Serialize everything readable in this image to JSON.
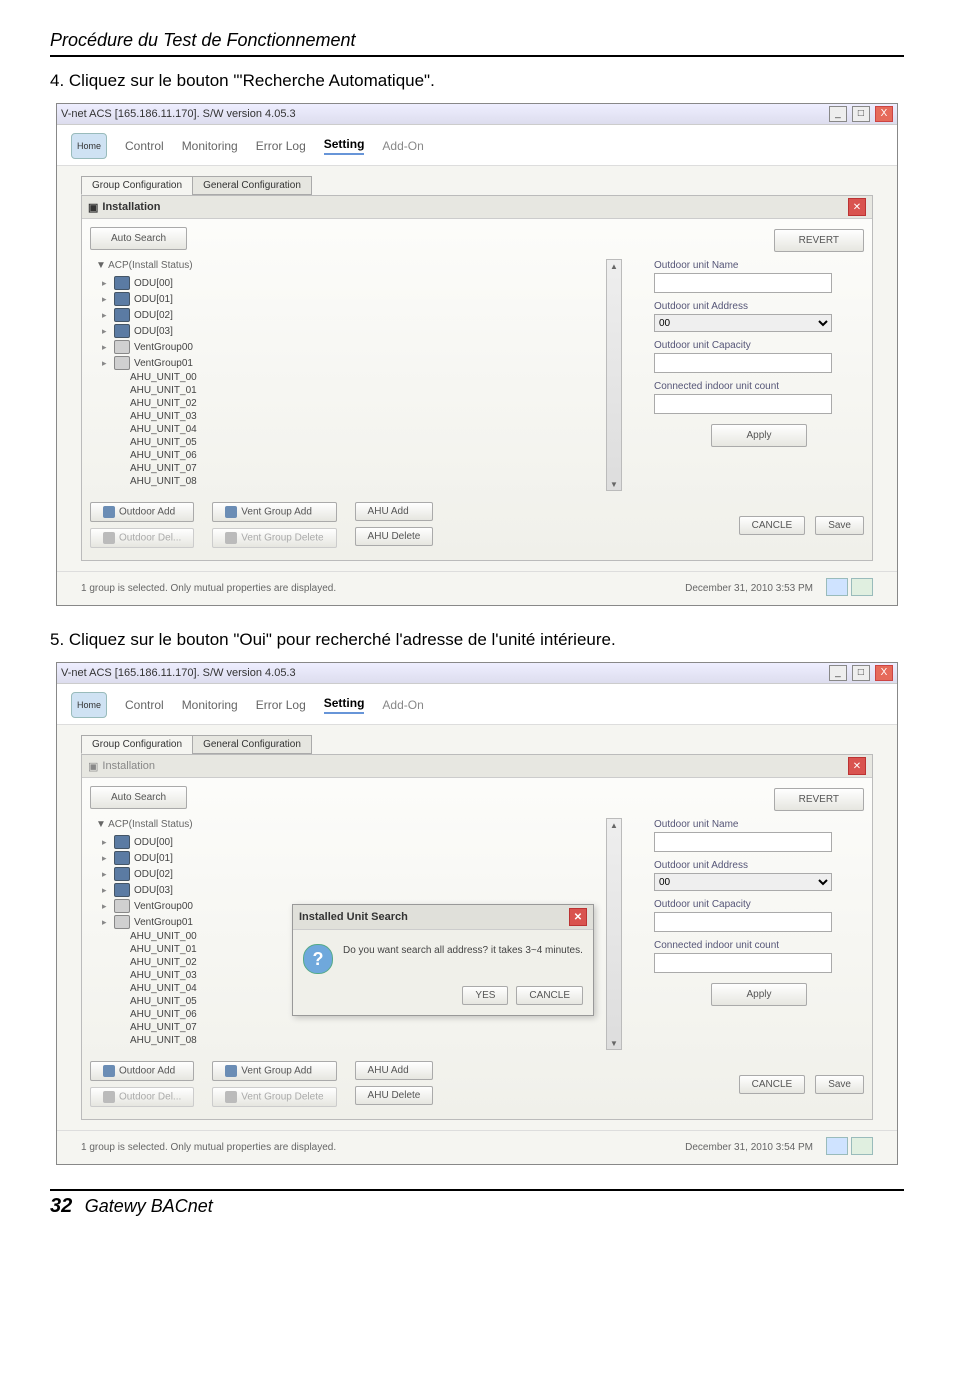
{
  "doc": {
    "section_header": "Procédure du Test de Fonctionnement",
    "step4": "4. Cliquez sur le bouton \"'Recherche Automatique\".",
    "step5": "5. Cliquez sur le bouton \"Oui\" pour recherché l'adresse de l'unité intérieure.",
    "page_number": "32",
    "book_title": "Gatewy BACnet"
  },
  "app": {
    "window_title": "V-net ACS [165.186.11.170].   S/W version 4.05.3",
    "wincontrols": {
      "min": "_",
      "max": "□",
      "close": "X"
    },
    "tabs": {
      "home": "Home",
      "control": "Control",
      "monitoring": "Monitoring",
      "errorlog": "Error Log",
      "setting": "Setting",
      "addon": "Add-On"
    },
    "subtabs": {
      "group": "Group Configuration",
      "general": "General Configuration"
    },
    "panel_title": "Installation",
    "auto_search": "Auto Search",
    "revert": "REVERT",
    "tree_header": "▼ ACP(Install Status)",
    "tree": {
      "odu": [
        "ODU[00]",
        "ODU[01]",
        "ODU[02]",
        "ODU[03]"
      ],
      "vg": [
        "VentGroup00",
        "VentGroup01"
      ],
      "ahu": [
        "AHU_UNIT_00",
        "AHU_UNIT_01",
        "AHU_UNIT_02",
        "AHU_UNIT_03",
        "AHU_UNIT_04",
        "AHU_UNIT_05",
        "AHU_UNIT_06",
        "AHU_UNIT_07",
        "AHU_UNIT_08"
      ]
    },
    "right": {
      "name_lbl": "Outdoor unit Name",
      "addr_lbl": "Outdoor unit Address",
      "addr_val": "00",
      "cap_lbl": "Outdoor unit Capacity",
      "count_lbl": "Connected indoor unit count",
      "apply": "Apply"
    },
    "buttons": {
      "outdoor_add": "Outdoor Add",
      "ventgroup_add": "Vent Group Add",
      "ahu_add": "AHU Add",
      "outdoor_del": "Outdoor Del...",
      "ventgroup_del": "Vent Group Delete",
      "ahu_del": "AHU Delete",
      "cancle": "CANCLE",
      "save": "Save"
    },
    "status": {
      "msg": "1 group is selected. Only mutual properties are displayed.",
      "time1": "December 31, 2010  3:53 PM",
      "time2": "December 31, 2010  3:54 PM"
    },
    "dialog": {
      "title": "Installed Unit Search",
      "msg": "Do you want search all address? it takes 3~4 minutes.",
      "yes": "YES",
      "cancle": "CANCLE"
    }
  }
}
